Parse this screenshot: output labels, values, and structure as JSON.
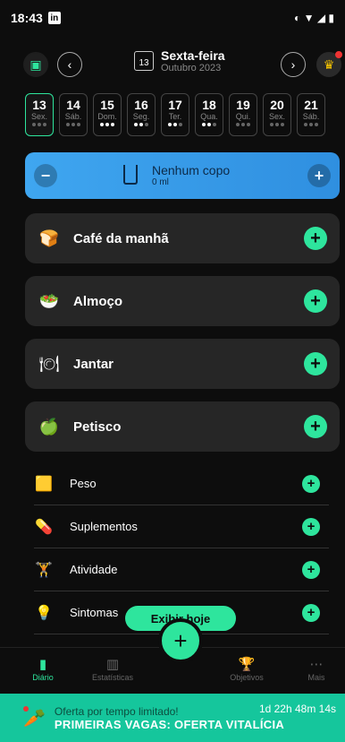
{
  "status": {
    "time": "18:43",
    "app_badge": "in",
    "right": "◐ ▼ ◢ ▮"
  },
  "header": {
    "weekday": "Sexta-feira",
    "month": "Outubro 2023",
    "day_icon_number": "13"
  },
  "day_strip": [
    {
      "num": "13",
      "lbl": "Sex.",
      "dots": [
        0,
        0,
        0
      ],
      "active": true
    },
    {
      "num": "14",
      "lbl": "Sáb.",
      "dots": [
        0,
        0,
        0
      ]
    },
    {
      "num": "15",
      "lbl": "Dom.",
      "dots": [
        1,
        1,
        1
      ]
    },
    {
      "num": "16",
      "lbl": "Seg.",
      "dots": [
        1,
        1,
        0
      ]
    },
    {
      "num": "17",
      "lbl": "Ter.",
      "dots": [
        1,
        1,
        0
      ]
    },
    {
      "num": "18",
      "lbl": "Qua.",
      "dots": [
        1,
        1,
        0
      ]
    },
    {
      "num": "19",
      "lbl": "Qui.",
      "dots": [
        0,
        0,
        0
      ]
    },
    {
      "num": "20",
      "lbl": "Sex.",
      "dots": [
        0,
        0,
        0
      ]
    },
    {
      "num": "21",
      "lbl": "Sáb.",
      "dots": [
        0,
        0,
        0
      ]
    }
  ],
  "water": {
    "title": "Nenhum copo",
    "amount": "0 ml"
  },
  "meals": [
    {
      "label": "Café da manhã",
      "icon": "bread-icon"
    },
    {
      "label": "Almoço",
      "icon": "bowl-icon"
    },
    {
      "label": "Jantar",
      "icon": "cloche-icon"
    },
    {
      "label": "Petisco",
      "icon": "apple-icon"
    }
  ],
  "extras": [
    {
      "label": "Peso",
      "icon": "scale-icon"
    },
    {
      "label": "Suplementos",
      "icon": "pill-icon"
    },
    {
      "label": "Atividade",
      "icon": "dumbbell-icon"
    },
    {
      "label": "Sintomas",
      "icon": "bulb-icon"
    }
  ],
  "show_today": "Exibir hoje",
  "nav": {
    "diary": "Diário",
    "stats": "Estatísticas",
    "goals": "Objetivos",
    "more": "Mais"
  },
  "promo": {
    "line1": "Oferta por tempo limitado!",
    "line2": "PRIMEIRAS VAGAS: OFERTA VITALÍCIA",
    "timer": "1d 22h 48m 14s"
  },
  "colors": {
    "accent": "#2ee59d",
    "water": "#3fa6f0",
    "promo": "#15c69c"
  }
}
